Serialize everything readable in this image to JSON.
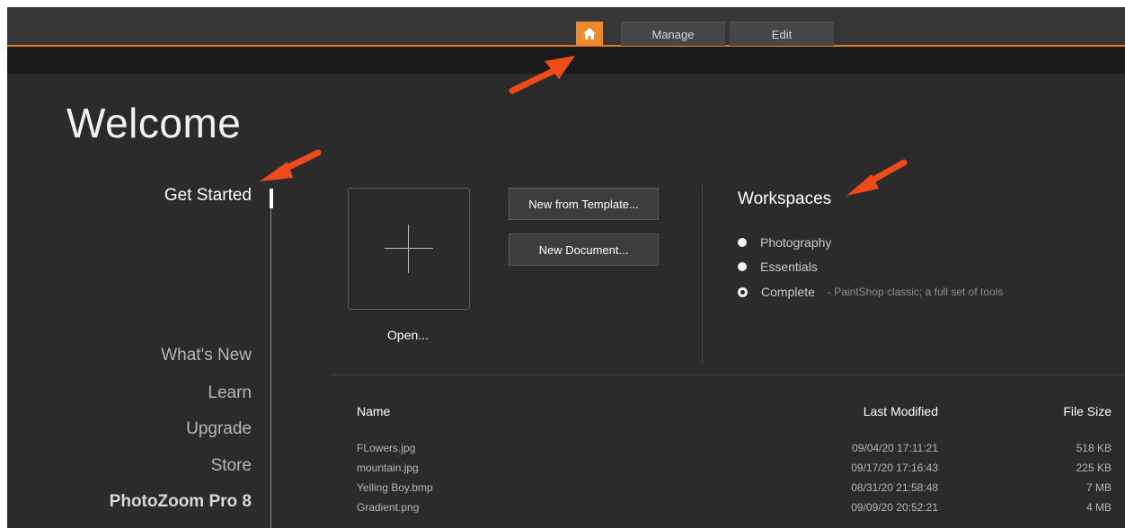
{
  "topbar": {
    "home_icon": "home-icon",
    "tabs": [
      {
        "label": "Manage"
      },
      {
        "label": "Edit"
      }
    ],
    "accent_color": "#ef8a2b"
  },
  "title": "Welcome",
  "nav": {
    "items": [
      {
        "label": "Get Started",
        "active": true
      },
      {
        "label": "What's New"
      },
      {
        "label": "Learn"
      },
      {
        "label": "Upgrade"
      },
      {
        "label": "Store"
      },
      {
        "label": "PhotoZoom Pro 8"
      }
    ]
  },
  "get_started": {
    "open_label": "Open...",
    "plus_icon": "plus-icon",
    "new_from_template": "New from Template...",
    "new_document": "New Document..."
  },
  "workspaces": {
    "title": "Workspaces",
    "options": [
      {
        "label": "Photography",
        "selected": false
      },
      {
        "label": "Essentials",
        "selected": false
      },
      {
        "label": "Complete",
        "selected": true,
        "description": "- PaintShop classic; a full set of tools"
      }
    ]
  },
  "recent_files": {
    "columns": {
      "name": "Name",
      "last_modified": "Last Modified",
      "file_size": "File Size"
    },
    "rows": [
      {
        "name": "FLowers.jpg",
        "modified": "09/04/20 17:11:21",
        "size": "518 KB"
      },
      {
        "name": "mountain.jpg",
        "modified": "09/17/20 17:16:43",
        "size": "225 KB"
      },
      {
        "name": "Yelling Boy.bmp",
        "modified": "08/31/20 21:58:48",
        "size": "7 MB"
      },
      {
        "name": "Gradient.png",
        "modified": "09/09/20 20:52:21",
        "size": "4 MB"
      }
    ]
  },
  "annotation_color": "#ee4a1a"
}
